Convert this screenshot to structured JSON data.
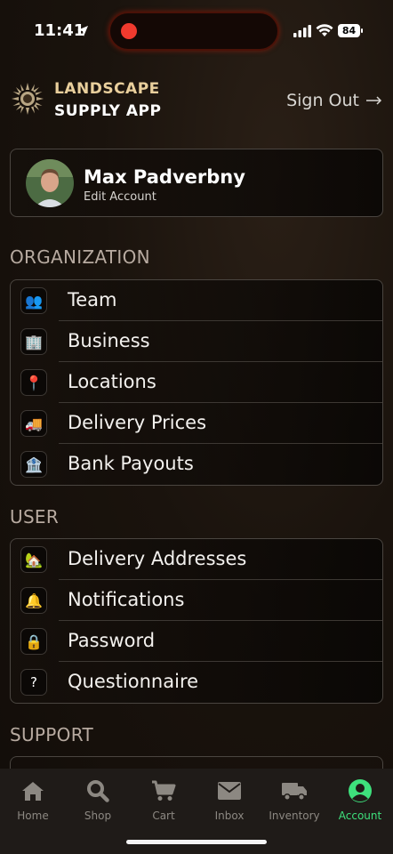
{
  "status_bar": {
    "time": "11:41",
    "battery": "84"
  },
  "header": {
    "brand_line1": "LANDSCAPE",
    "brand_line2": "SUPPLY APP",
    "sign_out": "Sign Out"
  },
  "profile": {
    "name": "Max Padverbny",
    "subtitle": "Edit Account"
  },
  "sections": {
    "organization": {
      "title": "ORGANIZATION",
      "items": [
        {
          "label": "Team",
          "icon": "team-icon",
          "emoji": "👥"
        },
        {
          "label": "Business",
          "icon": "building-icon",
          "emoji": "🏢"
        },
        {
          "label": "Locations",
          "icon": "pin-icon",
          "emoji": "📍"
        },
        {
          "label": "Delivery Prices",
          "icon": "truck-icon",
          "emoji": "🚚"
        },
        {
          "label": "Bank Payouts",
          "icon": "bank-icon",
          "emoji": "🏦"
        }
      ]
    },
    "user": {
      "title": "USER",
      "items": [
        {
          "label": "Delivery Addresses",
          "icon": "house-icon",
          "emoji": "🏡"
        },
        {
          "label": "Notifications",
          "icon": "bell-icon",
          "emoji": "🔔"
        },
        {
          "label": "Password",
          "icon": "lock-icon",
          "emoji": "🔒"
        },
        {
          "label": "Questionnaire",
          "icon": "question-icon",
          "emoji": "?"
        }
      ]
    },
    "support": {
      "title": "SUPPORT"
    }
  },
  "tabs": [
    {
      "label": "Home",
      "icon": "home-icon",
      "active": false
    },
    {
      "label": "Shop",
      "icon": "search-icon",
      "active": false
    },
    {
      "label": "Cart",
      "icon": "cart-icon",
      "active": false
    },
    {
      "label": "Inbox",
      "icon": "envelope-icon",
      "active": false
    },
    {
      "label": "Inventory",
      "icon": "truck-icon",
      "active": false
    },
    {
      "label": "Account",
      "icon": "account-icon",
      "active": true
    }
  ],
  "colors": {
    "accent": "#3ee07c",
    "brand_gold": "#e9cf9c",
    "background": "#1a130d"
  }
}
